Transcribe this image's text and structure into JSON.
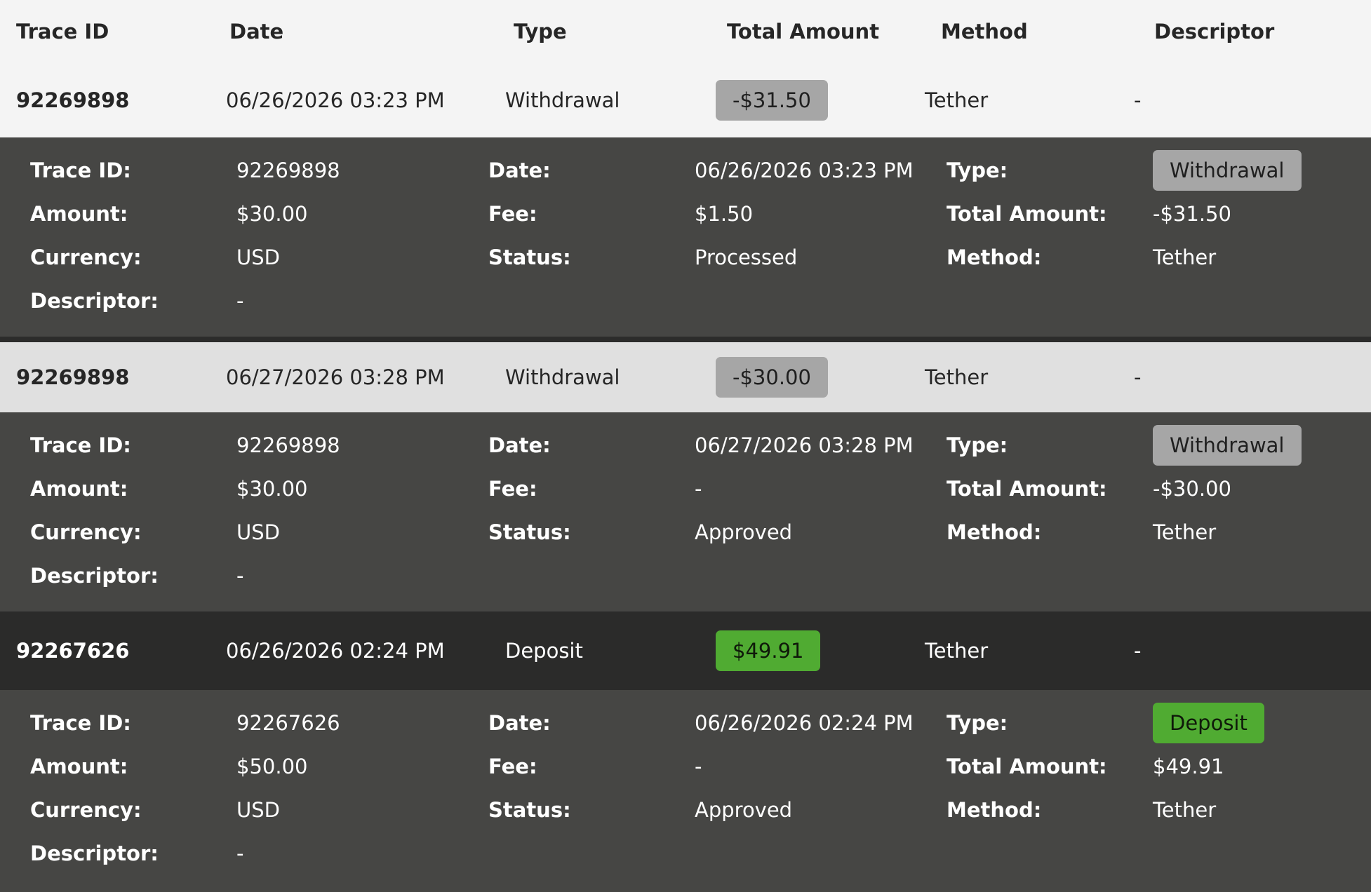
{
  "headers": {
    "trace_id": "Trace ID",
    "date": "Date",
    "type": "Type",
    "total_amount": "Total Amount",
    "method": "Method",
    "descriptor": "Descriptor"
  },
  "labels": {
    "trace_id": "Trace ID:",
    "date": "Date:",
    "type": "Type:",
    "amount": "Amount:",
    "fee": "Fee:",
    "total_amount": "Total Amount:",
    "currency": "Currency:",
    "status": "Status:",
    "method": "Method:",
    "descriptor": "Descriptor:"
  },
  "transactions": [
    {
      "trace_id": "92269898",
      "date": "06/26/2026 03:23 PM",
      "type": "Withdrawal",
      "total_amount": "-$31.50",
      "method": "Tether",
      "descriptor": "-",
      "amount": "$30.00",
      "fee": "$1.50",
      "currency": "USD",
      "status": "Processed"
    },
    {
      "trace_id": "92269898",
      "date": "06/27/2026 03:28 PM",
      "type": "Withdrawal",
      "total_amount": "-$30.00",
      "method": "Tether",
      "descriptor": "-",
      "amount": "$30.00",
      "fee": "-",
      "currency": "USD",
      "status": "Approved"
    },
    {
      "trace_id": "92267626",
      "date": "06/26/2026 02:24 PM",
      "type": "Deposit",
      "total_amount": "$49.91",
      "method": "Tether",
      "descriptor": "-",
      "amount": "$50.00",
      "fee": "-",
      "currency": "USD",
      "status": "Approved"
    }
  ],
  "colors": {
    "withdrawal_badge": "#a6a6a6",
    "deposit_badge": "#50ab32",
    "detail_bg": "#464644",
    "row_light": "#f4f4f4",
    "row_selected": "#e0e0e0",
    "row_dark": "#2b2b2a"
  }
}
